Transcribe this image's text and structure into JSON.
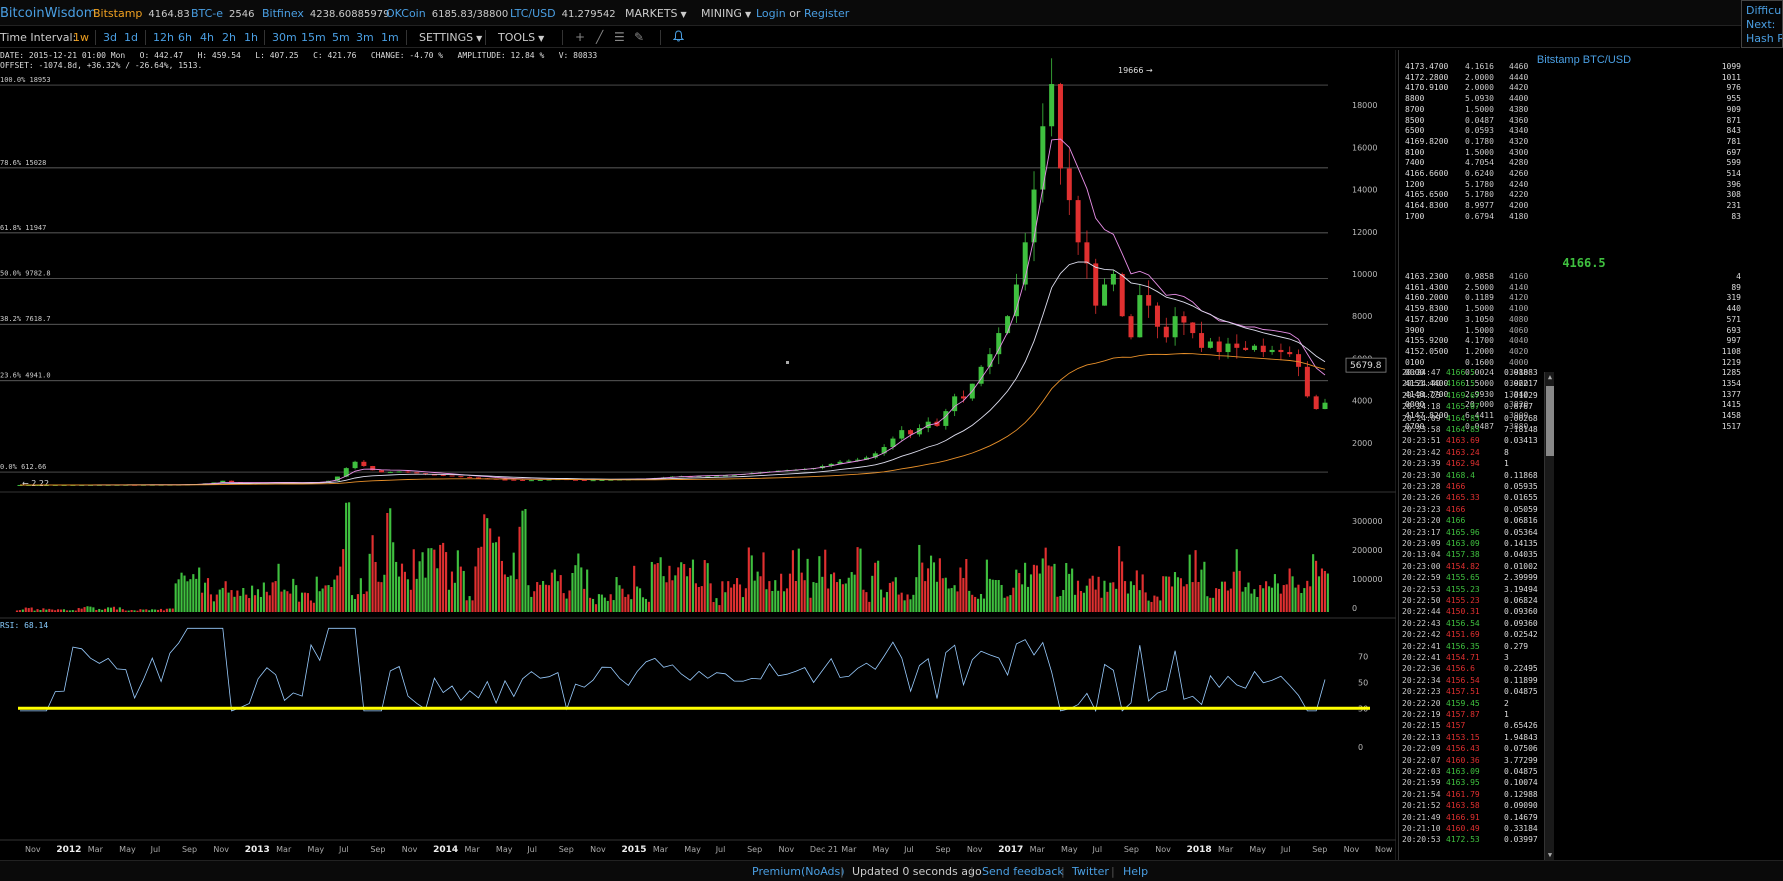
{
  "topbar": {
    "brand": "BitcoinWisdom",
    "exchanges": [
      {
        "name": "Bitstamp",
        "value": "4164.83",
        "active": true
      },
      {
        "name": "BTC-e",
        "value": "2546",
        "active": false
      },
      {
        "name": "Bitfinex",
        "value": "4238.60885979",
        "active": false
      },
      {
        "name": "OKCoin",
        "value": "6185.83/38800",
        "active": false
      },
      {
        "name": "LTC/USD",
        "value": "41.279542",
        "active": false
      }
    ],
    "markets": "MARKETS",
    "mining": "MINING",
    "login": "Login",
    "or": "or",
    "register": "Register",
    "difficulty": [
      "Difficul",
      "Next:",
      "Hash Ra"
    ]
  },
  "toolbar": {
    "time_interval": "Time Interval:",
    "intervals": [
      "1w",
      "3d",
      "1d",
      "12h",
      "6h",
      "4h",
      "2h",
      "1h",
      "30m",
      "15m",
      "5m",
      "3m",
      "1m"
    ],
    "active_interval": "1w",
    "settings": "SETTINGS",
    "tools": "TOOLS",
    "tool_icons": [
      "crosshair-icon",
      "line-icon",
      "fib-icon",
      "brush-icon"
    ]
  },
  "ohlc": {
    "line1": "DATE: 2015-12-21 01:00 Mon   O: 442.47   H: 459.54   L: 407.25   C: 421.76   CHANGE: -4.70 %   AMPLITUDE: 12.84 %   V: 80833",
    "line2": "OFFSET: -1074.8d, +36.32% / -26.64%, 1513."
  },
  "chart_data": {
    "type": "candlestick",
    "series_note": "weekly BTC/USD price",
    "fib_levels": [
      {
        "label": "100.0% 18953",
        "value": 18953
      },
      {
        "label": "78.6% 15028",
        "value": 15028
      },
      {
        "label": "61.8% 11947",
        "value": 11947
      },
      {
        "label": "50.0% 9782.8",
        "value": 9782.8
      },
      {
        "label": "38.2% 7618.7",
        "value": 7618.7
      },
      {
        "label": "23.6% 4941.0",
        "value": 4941.0
      },
      {
        "label": "0.0% 612.66",
        "value": 612.66
      }
    ],
    "high_marker": "19666",
    "low_marker": "2.22",
    "last_price_label": "5679.8",
    "price_axis": [
      18000,
      16000,
      14000,
      12000,
      10000,
      8000,
      6000,
      4000,
      2000
    ],
    "price_ylim": [
      0,
      19666
    ],
    "volume_axis": [
      "300000",
      "200000",
      "100000",
      "0"
    ],
    "volume_max": 380000,
    "rsi_label": "RSI: 68.14",
    "rsi_axis": [
      "70",
      "50",
      "30",
      "0"
    ],
    "rsi_line_level": 30,
    "x_labels": [
      "Nov",
      "2012",
      "Mar",
      "May",
      "Jul",
      "Sep",
      "Nov",
      "2013",
      "Mar",
      "May",
      "Jul",
      "Sep",
      "Nov",
      "2014",
      "Mar",
      "May",
      "Jul",
      "Sep",
      "Nov",
      "2015",
      "Mar",
      "May",
      "Jul",
      "Sep",
      "Nov",
      "Dec 21",
      "Mar",
      "May",
      "Jul",
      "Sep",
      "Nov",
      "2017",
      "Mar",
      "May",
      "Jul",
      "Sep",
      "Nov",
      "2018",
      "Mar",
      "May",
      "Jul",
      "Sep",
      "Nov",
      "Now"
    ],
    "close_path": [
      2,
      3,
      4,
      5,
      5,
      5,
      6,
      7,
      8,
      9,
      10,
      11,
      12,
      11,
      12,
      13,
      14,
      16,
      20,
      30,
      45,
      80,
      120,
      200,
      130,
      110,
      95,
      100,
      110,
      120,
      115,
      105,
      100,
      120,
      140,
      200,
      400,
      800,
      1100,
      900,
      700,
      600,
      620,
      640,
      600,
      560,
      500,
      480,
      450,
      420,
      380,
      360,
      320,
      300,
      260,
      250,
      240,
      230,
      230,
      240,
      260,
      280,
      250,
      240,
      230,
      230,
      240,
      250,
      260,
      270,
      280,
      300,
      330,
      360,
      400,
      420,
      410,
      430,
      440,
      450,
      460,
      480,
      520,
      560,
      600,
      640,
      680,
      700,
      720,
      760,
      800,
      900,
      1000,
      1100,
      1150,
      1200,
      1300,
      1500,
      1800,
      2200,
      2600,
      2400,
      2700,
      3000,
      2800,
      3500,
      4200,
      4100,
      4800,
      5600,
      6200,
      7200,
      8000,
      9500,
      11500,
      14000,
      17000,
      19000,
      15000,
      13500,
      11500,
      10500,
      8500,
      9500,
      10000,
      8000,
      7000,
      9000,
      8500,
      7500,
      7000,
      8000,
      7700,
      7200,
      6500,
      6800,
      6300,
      6700,
      6500,
      6400,
      6600,
      6300,
      6400,
      6300,
      6200,
      5600,
      4200,
      3600,
      3900
    ]
  },
  "orderbook": {
    "title": "Bitstamp BTC/USD",
    "asks": [
      [
        "4173.4700",
        "4.1616",
        "4460",
        "1099"
      ],
      [
        "4172.2800",
        "2.0000",
        "4440",
        "1011"
      ],
      [
        "4170.9100",
        "2.0000",
        "4420",
        "976"
      ],
      [
        "8800",
        "5.0930",
        "4400",
        "955"
      ],
      [
        "8700",
        "1.5000",
        "4380",
        "909"
      ],
      [
        "8500",
        "0.0487",
        "4360",
        "871"
      ],
      [
        "6500",
        "0.0593",
        "4340",
        "843"
      ],
      [
        "4169.8200",
        "0.1780",
        "4320",
        "781"
      ],
      [
        "8100",
        "1.5000",
        "4300",
        "697"
      ],
      [
        "7400",
        "4.7054",
        "4280",
        "599"
      ],
      [
        "4166.6600",
        "0.6240",
        "4260",
        "514"
      ],
      [
        "1200",
        "5.1780",
        "4240",
        "396"
      ],
      [
        "4165.6500",
        "5.1780",
        "4220",
        "308"
      ],
      [
        "4164.8300",
        "8.9977",
        "4200",
        "231"
      ],
      [
        "1700",
        "0.6794",
        "4180",
        "83"
      ]
    ],
    "mid": "4166.5",
    "bids": [
      [
        "4163.2300",
        "0.9858",
        "4160",
        "4"
      ],
      [
        "4161.4300",
        "2.5000",
        "4140",
        "89"
      ],
      [
        "4160.2000",
        "0.1189",
        "4120",
        "319"
      ],
      [
        "4159.8300",
        "1.5000",
        "4100",
        "440"
      ],
      [
        "4157.8200",
        "3.1050",
        "4080",
        "571"
      ],
      [
        "3900",
        "1.5000",
        "4060",
        "693"
      ],
      [
        "4155.9200",
        "4.1700",
        "4040",
        "997"
      ],
      [
        "4152.0500",
        "1.2000",
        "4020",
        "1108"
      ],
      [
        "0100",
        "0.1600",
        "4000",
        "1219"
      ],
      [
        "0000",
        "0.0024",
        "3980",
        "1285"
      ],
      [
        "4151.4400",
        "1.5000",
        "3960",
        "1354"
      ],
      [
        "4148.7700",
        "2.9930",
        "3940",
        "1377"
      ],
      [
        "0000",
        "20.000",
        "3920",
        "1415"
      ],
      [
        "4147.8200",
        "6.4411",
        "3900",
        "1458"
      ],
      [
        "0700",
        "0.0487",
        "3880",
        "1517"
      ]
    ]
  },
  "trades": [
    [
      "20:24:47",
      "4166.5",
      "0.01883",
      "up"
    ],
    [
      "20:24:40",
      "4166.5",
      "0.02217",
      "up"
    ],
    [
      "20:24:25",
      "4169.67",
      "1.01029",
      "up"
    ],
    [
      "20:24:18",
      "4165.07",
      "0.6767",
      "up"
    ],
    [
      "20:24:09",
      "4164.83",
      "0.00268",
      "up"
    ],
    [
      "20:23:58",
      "4164.83",
      "7.18148",
      "up"
    ],
    [
      "20:23:51",
      "4163.69",
      "0.03413",
      "dn"
    ],
    [
      "20:23:42",
      "4163.24",
      "8",
      "dn"
    ],
    [
      "20:23:39",
      "4162.94",
      "1",
      "dn"
    ],
    [
      "20:23:30",
      "4168.4",
      "0.11868",
      "up"
    ],
    [
      "20:23:28",
      "4166",
      "0.05935",
      "dn"
    ],
    [
      "20:23:26",
      "4165.33",
      "0.01655",
      "dn"
    ],
    [
      "20:23:23",
      "4166",
      "0.05059",
      "dn"
    ],
    [
      "20:23:20",
      "4166",
      "0.06816",
      "up"
    ],
    [
      "20:23:17",
      "4165.96",
      "0.05364",
      "up"
    ],
    [
      "20:23:09",
      "4163.09",
      "0.14135",
      "up"
    ],
    [
      "20:13:04",
      "4157.38",
      "0.04035",
      "up"
    ],
    [
      "20:23:00",
      "4154.82",
      "0.01002",
      "dn"
    ],
    [
      "20:22:59",
      "4155.65",
      "2.39999",
      "up"
    ],
    [
      "20:22:53",
      "4155.23",
      "3.19494",
      "up"
    ],
    [
      "20:22:50",
      "4155.23",
      "0.06824",
      "dn"
    ],
    [
      "20:22:44",
      "4150.31",
      "0.09360",
      "dn"
    ],
    [
      "20:22:43",
      "4156.54",
      "0.09360",
      "up"
    ],
    [
      "20:22:42",
      "4151.69",
      "0.02542",
      "dn"
    ],
    [
      "20:22:41",
      "4156.35",
      "0.279",
      "up"
    ],
    [
      "20:22:41",
      "4154.71",
      "3",
      "dn"
    ],
    [
      "20:22:36",
      "4156.6",
      "0.22495",
      "dn"
    ],
    [
      "20:22:34",
      "4156.54",
      "0.11899",
      "dn"
    ],
    [
      "20:22:23",
      "4157.51",
      "0.04875",
      "dn"
    ],
    [
      "20:22:20",
      "4159.45",
      "2",
      "up"
    ],
    [
      "20:22:19",
      "4157.87",
      "1",
      "dn"
    ],
    [
      "20:22:15",
      "4157",
      "0.65426",
      "dn"
    ],
    [
      "20:22:13",
      "4153.15",
      "1.94843",
      "dn"
    ],
    [
      "20:22:09",
      "4156.43",
      "0.07506",
      "dn"
    ],
    [
      "20:22:07",
      "4160.36",
      "3.77299",
      "dn"
    ],
    [
      "20:22:03",
      "4163.09",
      "0.04875",
      "up"
    ],
    [
      "20:21:59",
      "4163.95",
      "0.10074",
      "up"
    ],
    [
      "20:21:54",
      "4161.79",
      "0.12988",
      "dn"
    ],
    [
      "20:21:52",
      "4163.58",
      "0.09090",
      "dn"
    ],
    [
      "20:21:49",
      "4166.91",
      "0.14679",
      "dn"
    ],
    [
      "20:21:10",
      "4160.49",
      "0.33184",
      "dn"
    ],
    [
      "20:20:53",
      "4172.53",
      "0.03997",
      "up"
    ]
  ],
  "footer": {
    "premium": "Premium(NoAds)",
    "updated": "Updated 0 seconds ago",
    "feedback": "Send feedback",
    "twitter": "Twitter",
    "help": "Help"
  },
  "colors": {
    "up": "#3fc03f",
    "down": "#e03030",
    "link": "#4a9fe3",
    "active": "#f0a020",
    "ema_slow": "#e88fe8",
    "ema_fast": "#dde",
    "ma_orange": "#e8902a",
    "rsi_level": "#ffff00"
  }
}
